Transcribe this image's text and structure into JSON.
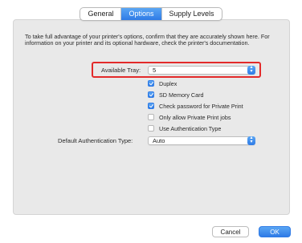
{
  "tabs": [
    {
      "label": "General",
      "active": false
    },
    {
      "label": "Options",
      "active": true
    },
    {
      "label": "Supply Levels",
      "active": false
    }
  ],
  "intro_text": "To take full advantage of your printer's options, confirm that they are accurately shown here. For information on your printer and its optional hardware, check the printer's documentation.",
  "available_tray": {
    "label": "Available Tray:",
    "value": "5"
  },
  "options": [
    {
      "label": "Duplex",
      "checked": true
    },
    {
      "label": "SD Memory Card",
      "checked": true
    },
    {
      "label": "Check password for Private Print",
      "checked": true
    },
    {
      "label": "Only allow Private Print jobs",
      "checked": false
    },
    {
      "label": "Use Authentication Type",
      "checked": false
    }
  ],
  "default_auth": {
    "label": "Default Authentication Type:",
    "value": "Auto"
  },
  "buttons": {
    "cancel": "Cancel",
    "ok": "OK"
  },
  "colors": {
    "accent": "#2f7be6",
    "highlight": "#e32a2a",
    "panel": "#e9e9e9"
  }
}
